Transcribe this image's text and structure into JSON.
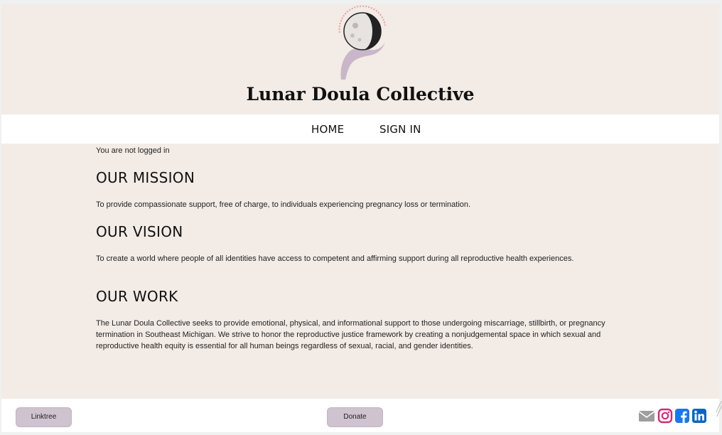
{
  "site": {
    "title": "Lunar Doula Collective",
    "logo_text": "LUNAR DOULA COLLECTIVE"
  },
  "nav": {
    "items": [
      {
        "label": "HOME"
      },
      {
        "label": "SIGN IN"
      }
    ]
  },
  "main": {
    "login_status": "You are not logged in",
    "sections": [
      {
        "heading": "OUR MISSION",
        "text": "To provide compassionate support, free of charge, to individuals experiencing pregnancy loss or termination."
      },
      {
        "heading": "OUR VISION",
        "text": "To create a world where people of all identities have access to competent and affirming support during all reproductive health experiences."
      },
      {
        "heading": "OUR WORK",
        "text": "The Lunar Doula Collective seeks to provide emotional, physical, and informational support to those undergoing miscarriage, stillbirth, or pregnancy termination in Southeast Michigan. We strive to honor the reproductive justice framework by creating a nonjudgemental space in which sexual and reproductive health equity is essential for all human beings regardless of sexual, racial, and gender identities."
      }
    ]
  },
  "footer": {
    "linktree_label": "Linktree",
    "donate_label": "Donate",
    "social_icons": [
      "mail-icon",
      "instagram-icon",
      "facebook-icon",
      "linkedin-icon"
    ]
  },
  "colors": {
    "page_bg": "#f2ebe6",
    "button_bg": "#cfc3cf",
    "instagram": "#d62976",
    "facebook": "#1877f2",
    "linkedin": "#0a66c2",
    "mail": "#9e9e9e"
  }
}
